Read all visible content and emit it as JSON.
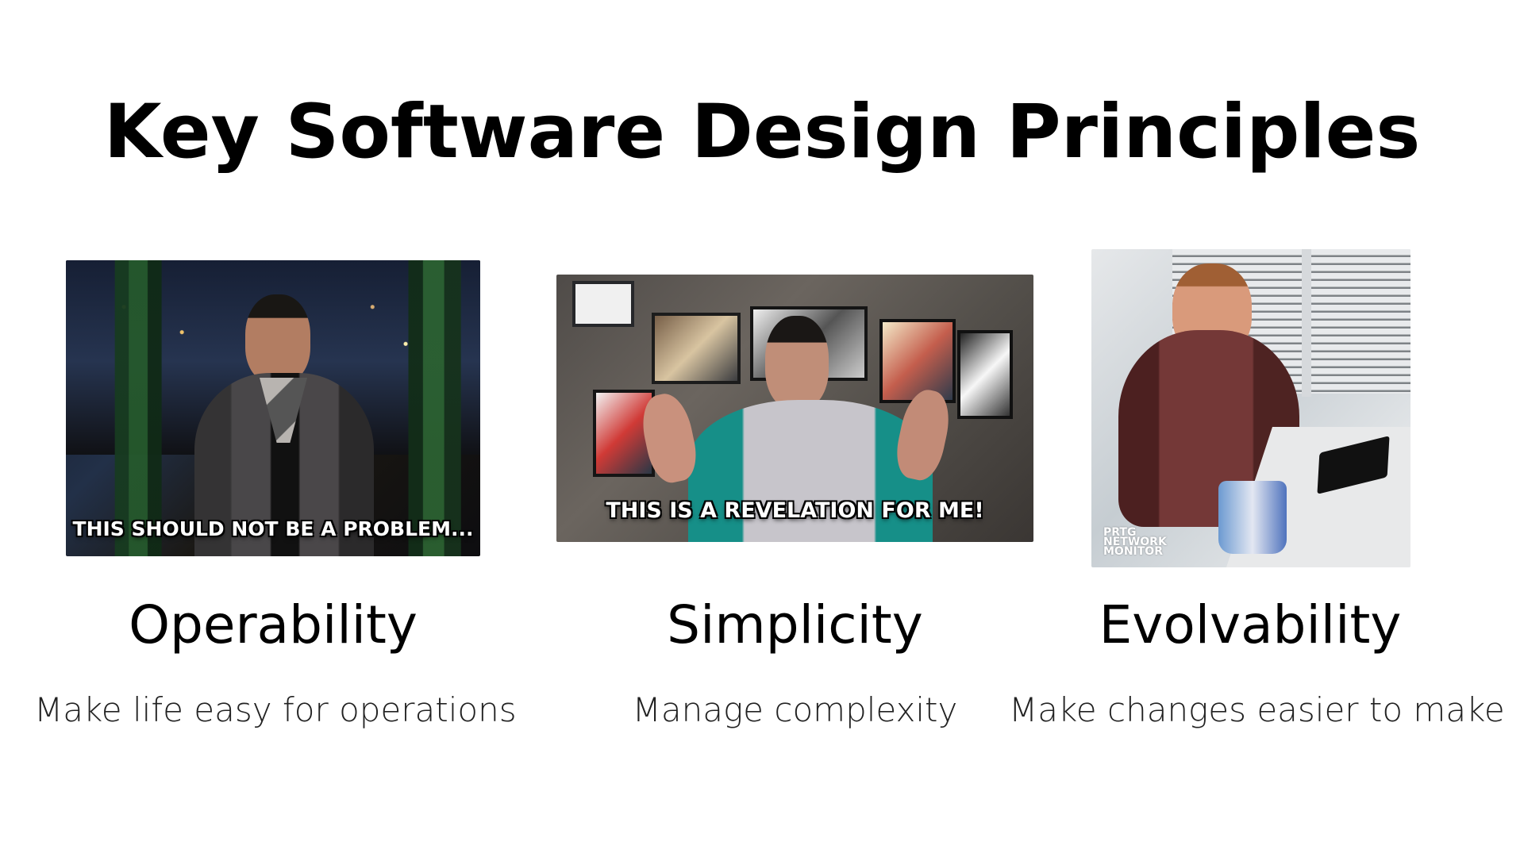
{
  "title": "Key Software Design Principles",
  "columns": [
    {
      "heading": "Operability",
      "description": "Make life easy for operations",
      "image_caption": "THIS SHOULD NOT BE A PROBLEM..."
    },
    {
      "heading": "Simplicity",
      "description": "Manage complexity",
      "image_caption": "THIS IS A REVELATION FOR ME!"
    },
    {
      "heading": "Evolvability",
      "description": "Make changes easier to make",
      "image_watermark": "PRTG\nNETWORK\nMONITOR"
    }
  ]
}
